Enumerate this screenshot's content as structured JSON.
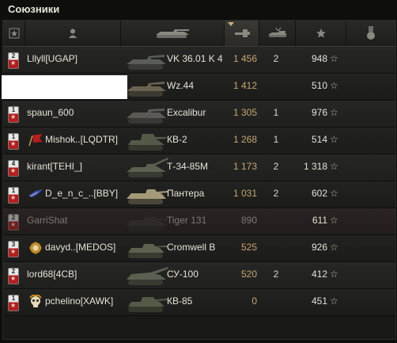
{
  "panel": {
    "title": "Союзники"
  },
  "columns": [
    {
      "name": "platoon",
      "icon": "star-icon"
    },
    {
      "name": "player",
      "icon": "player-icon"
    },
    {
      "name": "vehicle",
      "icon": "tank-icon"
    },
    {
      "name": "damage",
      "icon": "damage-icon",
      "sorted": true
    },
    {
      "name": "frags",
      "icon": "frags-icon"
    },
    {
      "name": "experience",
      "icon": "star-icon"
    },
    {
      "name": "achievements",
      "icon": "medal-icon"
    }
  ],
  "rows": [
    {
      "platoon": "2",
      "player": "Lllyll[UGAP]",
      "clan_icon": null,
      "tank": "VK 36.01 K 4",
      "damage": "1 456",
      "frags": "2",
      "xp": "948",
      "dead": false,
      "hidden": false
    },
    {
      "platoon": null,
      "player": "",
      "clan_icon": null,
      "tank": "Wz.44",
      "damage": "1 412",
      "frags": "",
      "xp": "510",
      "dead": false,
      "hidden": true
    },
    {
      "platoon": "1",
      "player": "spaun_600",
      "clan_icon": null,
      "tank": "Excalibur",
      "damage": "1 305",
      "frags": "1",
      "xp": "976",
      "dead": false,
      "hidden": false
    },
    {
      "platoon": "1",
      "player": "Mishok..[LQDTR]",
      "clan_icon": "flag-icon",
      "tank": "КВ-2",
      "damage": "1 268",
      "frags": "1",
      "xp": "514",
      "dead": false,
      "hidden": false
    },
    {
      "platoon": "4",
      "player": "kirant[TEHI_]",
      "clan_icon": null,
      "tank": "Т-34-85М",
      "damage": "1 173",
      "frags": "2",
      "xp": "1 318",
      "dead": false,
      "hidden": false
    },
    {
      "platoon": "1",
      "player": "D_e_n_c_..[BBY]",
      "clan_icon": "wings-icon",
      "tank": "Пантера",
      "damage": "1 031",
      "frags": "2",
      "xp": "602",
      "dead": false,
      "hidden": false
    },
    {
      "platoon": "2",
      "player": "GarriShat",
      "clan_icon": null,
      "tank": "Tiger 131",
      "damage": "890",
      "frags": "",
      "xp": "611",
      "dead": true,
      "hidden": false
    },
    {
      "platoon": "3",
      "player": "davyd..[MEDOS]",
      "clan_icon": "emblem-icon",
      "tank": "Cromwell B",
      "damage": "525",
      "frags": "",
      "xp": "926",
      "dead": false,
      "hidden": false
    },
    {
      "platoon": "2",
      "player": "lord68[4CB]",
      "clan_icon": null,
      "tank": "СУ-100",
      "damage": "520",
      "frags": "2",
      "xp": "412",
      "dead": false,
      "hidden": false
    },
    {
      "platoon": "1",
      "player": "pchelino[XAWK]",
      "clan_icon": "skull-icon",
      "tank": "КВ-85",
      "damage": "0",
      "frags": "",
      "xp": "451",
      "dead": false,
      "hidden": false
    }
  ],
  "colors": {
    "damage": "#c7a76e",
    "platoon_red": "#b41e1e",
    "text": "#e6e3d6"
  },
  "xp_star": "☆"
}
